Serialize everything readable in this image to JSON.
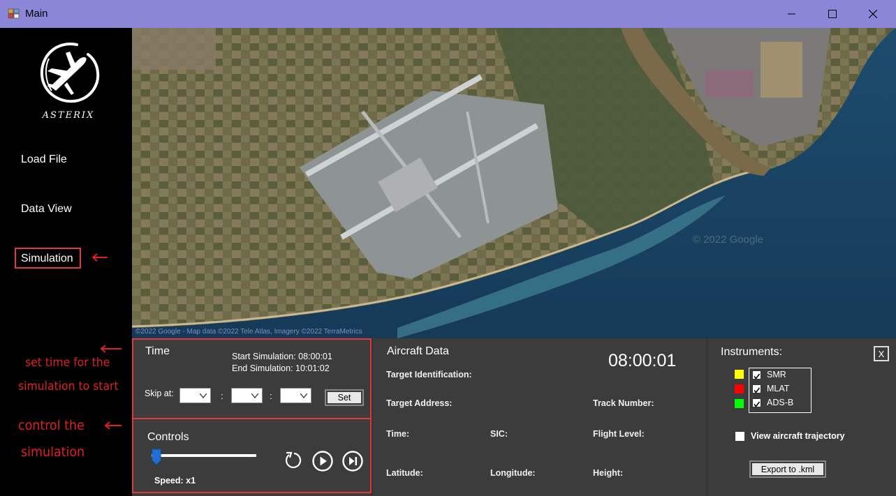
{
  "window": {
    "title": "Main"
  },
  "sidebar": {
    "logo_text": "ASTERIX",
    "items": [
      {
        "label": "Load File"
      },
      {
        "label": "Data View"
      },
      {
        "label": "Simulation"
      }
    ]
  },
  "annotations": {
    "time_note_1": "set time for the",
    "time_note_2": "simulation to start",
    "controls_note_1": "control the",
    "controls_note_2": "simulation"
  },
  "map": {
    "credit": "©2022 Google - Map data ©2022 Tele Atlas, Imagery ©2022 TerraMetrics",
    "watermark": "© 2022 Google"
  },
  "time_panel": {
    "title": "Time",
    "start_simulation": "Start Simulation: 08:00:01",
    "end_simulation": "End Simulation: 10:01:02",
    "skip_label": "Skip at:",
    "separator": ":",
    "set_button": "Set"
  },
  "controls_panel": {
    "title": "Controls",
    "speed": "Speed: x1",
    "slider_level": 0
  },
  "aircraft_panel": {
    "title": "Aircraft Data",
    "clock": "08:00:01",
    "target_identification": "Target Identification:",
    "target_address": "Target Address:",
    "track_number": "Track Number:",
    "time": "Time:",
    "sic": "SIC:",
    "flight_level": "Flight Level:",
    "latitude": "Latitude:",
    "longitude": "Longitude:",
    "height": "Height:"
  },
  "instruments_panel": {
    "title": "Instruments:",
    "close_button": "X",
    "instruments": [
      {
        "label": "SMR",
        "color": "#ffff00",
        "checked": true
      },
      {
        "label": "MLAT",
        "color": "#ff0000",
        "checked": true
      },
      {
        "label": "ADS-B",
        "color": "#00ff00",
        "checked": true
      }
    ],
    "trajectory_label": "View aircraft trajectory",
    "trajectory_checked": false,
    "export_button": "Export to .kml"
  }
}
